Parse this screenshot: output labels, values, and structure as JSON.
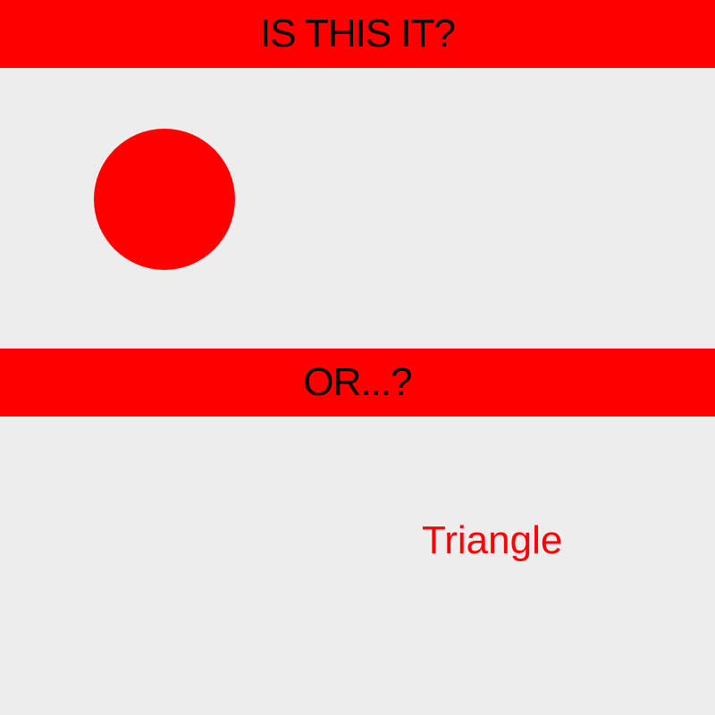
{
  "top_banner": {
    "text": "IS THIS IT?"
  },
  "middle_banner": {
    "text": "OR...?"
  },
  "shape_label": {
    "text": "Triangle"
  },
  "colors": {
    "background": "#ededed",
    "accent": "#ff0000",
    "banner_text": "#000000",
    "label_text": "#ff0000"
  }
}
